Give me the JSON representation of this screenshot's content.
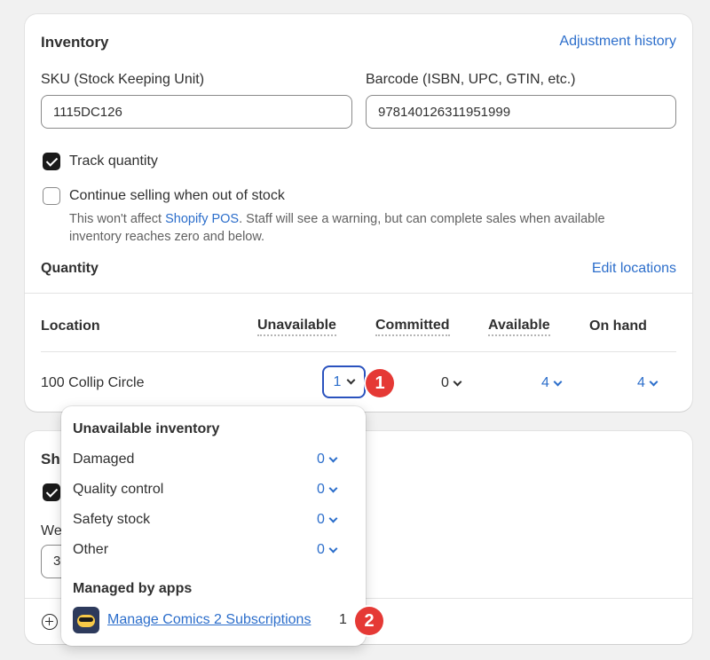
{
  "inventory": {
    "title": "Inventory",
    "adjustment_history_link": "Adjustment history",
    "sku_label": "SKU (Stock Keeping Unit)",
    "sku_value": "1115DC126",
    "barcode_label": "Barcode (ISBN, UPC, GTIN, etc.)",
    "barcode_value": "978140126311951999",
    "track_quantity_label": "Track quantity",
    "track_quantity_checked": true,
    "continue_selling_label": "Continue selling when out of stock",
    "continue_selling_checked": false,
    "help_prefix": "This won't affect",
    "help_link": "Shopify POS",
    "help_suffix": ". Staff will see a warning, but can complete sales when available",
    "help_line2": "inventory reaches zero and below.",
    "quantity_title": "Quantity",
    "edit_locations_link": "Edit locations",
    "columns": {
      "location": "Location",
      "unavailable": "Unavailable",
      "committed": "Committed",
      "available": "Available",
      "on_hand": "On hand"
    },
    "rows": [
      {
        "location": "100 Collip Circle",
        "unavailable": "1",
        "committed": "0",
        "available": "4",
        "on_hand": "4"
      }
    ]
  },
  "shipping_card": {
    "title_partial": "Sh",
    "weight_label_partial": "We",
    "weight_value_partial": "3"
  },
  "popover": {
    "title": "Unavailable inventory",
    "items": [
      {
        "label": "Damaged",
        "value": "0"
      },
      {
        "label": "Quality control",
        "value": "0"
      },
      {
        "label": "Safety stock",
        "value": "0"
      },
      {
        "label": "Other",
        "value": "0"
      }
    ],
    "managed_title": "Managed by apps",
    "app_name": "Manage Comics 2 Subscriptions",
    "app_count": "1"
  },
  "annotations": {
    "badge1": "1",
    "badge2": "2"
  },
  "colors": {
    "link_blue": "#2c6ecb",
    "focus_border": "#2a52be",
    "badge_red": "#e53935",
    "checkbox_dark": "#1a1a1a"
  },
  "icons": [
    "checkbox-icon",
    "chevron-down-icon",
    "plus-circle-icon",
    "app-logo-icon"
  ]
}
